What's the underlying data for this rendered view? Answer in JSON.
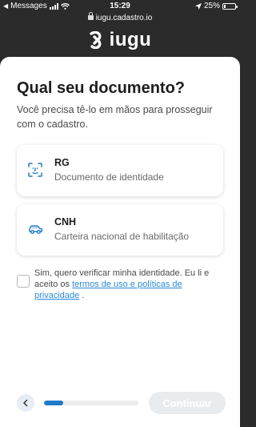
{
  "status_bar": {
    "back_app": "Messages",
    "time": "15:29",
    "battery": "25%",
    "battery_level": 0.25
  },
  "browser": {
    "url": "iugu.cadastro.io"
  },
  "brand": {
    "name": "iugu"
  },
  "page": {
    "title": "Qual seu documento?",
    "subtitle": "Você precisa tê-lo em mãos para prosseguir com o cadastro."
  },
  "options": [
    {
      "label": "RG",
      "description": "Documento de identidade",
      "icon": "face-id-icon"
    },
    {
      "label": "CNH",
      "description": "Carteira nacional de habilitação",
      "icon": "car-icon"
    }
  ],
  "consent": {
    "text_before": "Sim, quero verificar minha identidade. Eu li e aceito os ",
    "link_text": "termos de uso e políticas de privacidade",
    "text_after": " ."
  },
  "footer": {
    "continue_label": "Continuar",
    "progress": 0.2
  },
  "colors": {
    "accent": "#1e7bc8",
    "link": "#2b8ad6",
    "header_bg": "#2b2b2b"
  }
}
